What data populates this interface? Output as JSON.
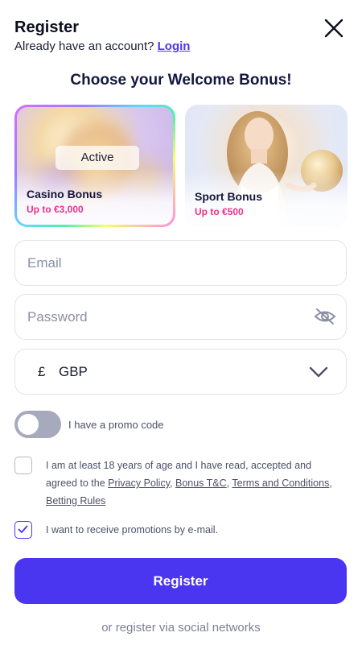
{
  "header": {
    "title": "Register",
    "subtitle_prefix": "Already have an account? ",
    "login_label": "Login"
  },
  "bonus": {
    "heading": "Choose your Welcome Bonus!",
    "cards": [
      {
        "label": "Casino Bonus",
        "amount": "Up to €3,000",
        "tag": "Active"
      },
      {
        "label": "Sport Bonus",
        "amount": "Up to €500"
      }
    ]
  },
  "form": {
    "email_placeholder": "Email",
    "password_placeholder": "Password",
    "currency_symbol": "£",
    "currency_code": "GBP",
    "promo_label": "I have a promo code",
    "terms_prefix": "I am at least 18 years of age and I have read, accepted and agreed to the ",
    "privacy_link": "Privacy Policy",
    "bonus_link": "Bonus T&C",
    "terms_link": "Terms and Conditions",
    "betting_link": "Betting Rules",
    "promotions_label": "I want to receive promotions by e-mail.",
    "register_label": "Register",
    "social_label": "or register via social networks"
  },
  "colors": {
    "accent": "#4a36f0",
    "amount": "#e8338a"
  }
}
